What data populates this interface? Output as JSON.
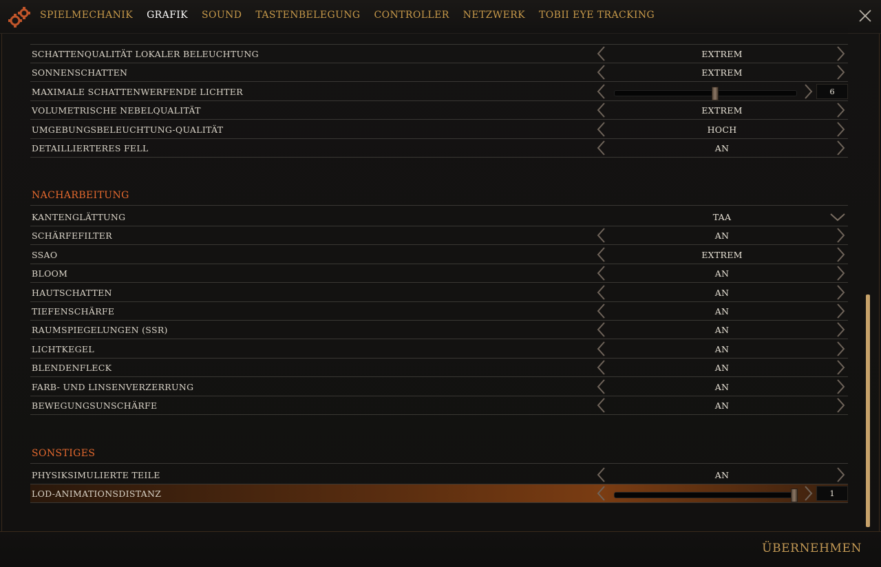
{
  "tabs": [
    "SPIELMECHANIK",
    "GRAFIK",
    "SOUND",
    "TASTENBELEGUNG",
    "CONTROLLER",
    "NETZWERK",
    "TOBII EYE TRACKING"
  ],
  "active_tab": "GRAFIK",
  "rows_top": [
    {
      "label": "SCHATTENQUALITÄT LOKALER BELEUCHTUNG",
      "value": "EXTREM"
    },
    {
      "label": "SONNENSCHATTEN",
      "value": "EXTREM"
    },
    {
      "label": "MAXIMALE SCHATTENWERFENDE LICHTER",
      "slider_value": "6",
      "slider_fraction": 0.55
    },
    {
      "label": "VOLUMETRISCHE NEBELQUALITÄT",
      "value": "EXTREM"
    },
    {
      "label": "UMGEBUNGSBELEUCHTUNG-QUALITÄT",
      "value": "HOCH"
    },
    {
      "label": "DETAILLIERTERES FELL",
      "value": "AN"
    }
  ],
  "section_post": "NACHARBEITUNG",
  "rows_post": [
    {
      "label": "KANTENGLÄTTUNG",
      "value": "TAA",
      "dropdown": true
    },
    {
      "label": "SCHÄRFEFILTER",
      "value": "AN"
    },
    {
      "label": "SSAO",
      "value": "EXTREM"
    },
    {
      "label": "BLOOM",
      "value": "AN"
    },
    {
      "label": "HAUTSCHATTEN",
      "value": "AN"
    },
    {
      "label": "TIEFENSCHÄRFE",
      "value": "AN"
    },
    {
      "label": "RAUMSPIEGELUNGEN (SSR)",
      "value": "AN"
    },
    {
      "label": "LICHTKEGEL",
      "value": "AN"
    },
    {
      "label": "BLENDENFLECK",
      "value": "AN"
    },
    {
      "label": "FARB- UND LINSENVERZERRUNG",
      "value": "AN"
    },
    {
      "label": "BEWEGUNGSUNSCHÄRFE",
      "value": "AN"
    }
  ],
  "section_misc": "SONSTIGES",
  "rows_misc": [
    {
      "label": "PHYSIKSIMULIERTE TEILE",
      "value": "AN"
    },
    {
      "label": "LOD-ANIMATIONSDISTANZ",
      "slider_value": "1",
      "slider_fraction": 1.0
    }
  ],
  "apply_label": "ÜBERNEHMEN",
  "colors": {
    "accent": "#e4692e",
    "gold": "#c89a4a",
    "scroll": "#c7a26a"
  }
}
